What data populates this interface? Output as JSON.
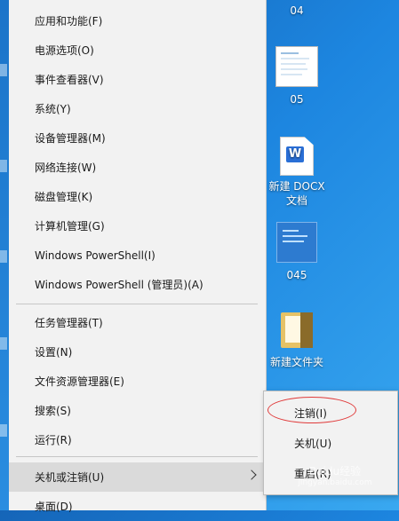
{
  "winx_menu": {
    "items": [
      {
        "label": "应用和功能(F)"
      },
      {
        "label": "电源选项(O)"
      },
      {
        "label": "事件查看器(V)"
      },
      {
        "label": "系统(Y)"
      },
      {
        "label": "设备管理器(M)"
      },
      {
        "label": "网络连接(W)"
      },
      {
        "label": "磁盘管理(K)"
      },
      {
        "label": "计算机管理(G)"
      },
      {
        "label": "Windows PowerShell(I)"
      },
      {
        "label": "Windows PowerShell (管理员)(A)"
      },
      {
        "label": "任务管理器(T)"
      },
      {
        "label": "设置(N)"
      },
      {
        "label": "文件资源管理器(E)"
      },
      {
        "label": "搜索(S)"
      },
      {
        "label": "运行(R)"
      },
      {
        "label": "关机或注销(U)",
        "highlighted": true,
        "has_submenu": true
      },
      {
        "label": "桌面(D)"
      }
    ]
  },
  "submenu": {
    "items": [
      {
        "label": "注销(I)",
        "circled": true
      },
      {
        "label": "关机(U)"
      },
      {
        "label": "重启(R)"
      }
    ]
  },
  "desktop_icons": [
    {
      "label": "04"
    },
    {
      "label": "05"
    },
    {
      "label": "新建 DOCX\n文档"
    },
    {
      "label": "045"
    },
    {
      "label": "新建文件夹"
    }
  ],
  "watermark": {
    "text": "Baidu经验",
    "url": "jingyan.baidu.com"
  },
  "colors": {
    "menu_bg": "#f2f2f2",
    "highlight": "#dadada",
    "desktop_accent": "#1d86e0",
    "circle": "#e03a3a"
  }
}
